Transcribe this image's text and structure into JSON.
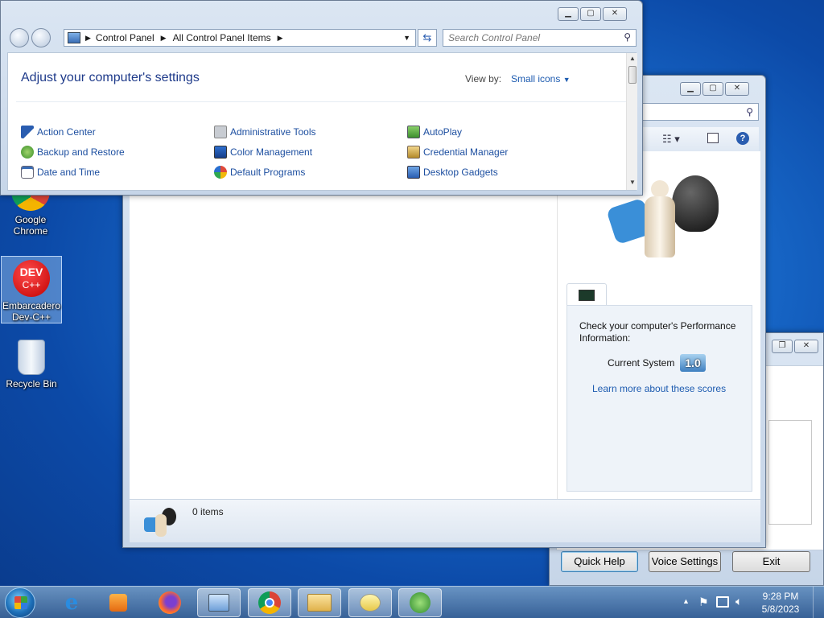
{
  "desktop": {
    "icons": [
      {
        "label": "Google Chrome"
      },
      {
        "label": "Embarcadero Dev-C++"
      },
      {
        "label": "Recycle Bin"
      }
    ]
  },
  "control_panel": {
    "breadcrumb": [
      "Control Panel",
      "All Control Panel Items"
    ],
    "search_placeholder": "Search Control Panel",
    "heading": "Adjust your computer's settings",
    "view_by_label": "View by:",
    "view_by_value": "Small icons",
    "items": [
      {
        "label": "Action Center",
        "icon": "flag-icon"
      },
      {
        "label": "Administrative Tools",
        "icon": "tools-icon"
      },
      {
        "label": "AutoPlay",
        "icon": "autoplay-icon"
      },
      {
        "label": "Backup and Restore",
        "icon": "backup-icon"
      },
      {
        "label": "Color Management",
        "icon": "monitor-icon"
      },
      {
        "label": "Credential Manager",
        "icon": "vault-icon"
      },
      {
        "label": "Date and Time",
        "icon": "clock-icon"
      },
      {
        "label": "Default Programs",
        "icon": "globe-icon"
      },
      {
        "label": "Desktop Gadgets",
        "icon": "gadget-icon"
      }
    ]
  },
  "games_window": {
    "perf_text": "Check your computer's Performance Information:",
    "current_system_label": "Current System",
    "score": "1.0",
    "learn_more": "Learn more about these scores",
    "status_items": "0 items"
  },
  "speech_window": {
    "buttons": [
      "Quick Help",
      "Voice Settings",
      "Exit"
    ]
  },
  "taskbar": {
    "clock_time": "9:28 PM",
    "clock_date": "5/8/2023"
  }
}
